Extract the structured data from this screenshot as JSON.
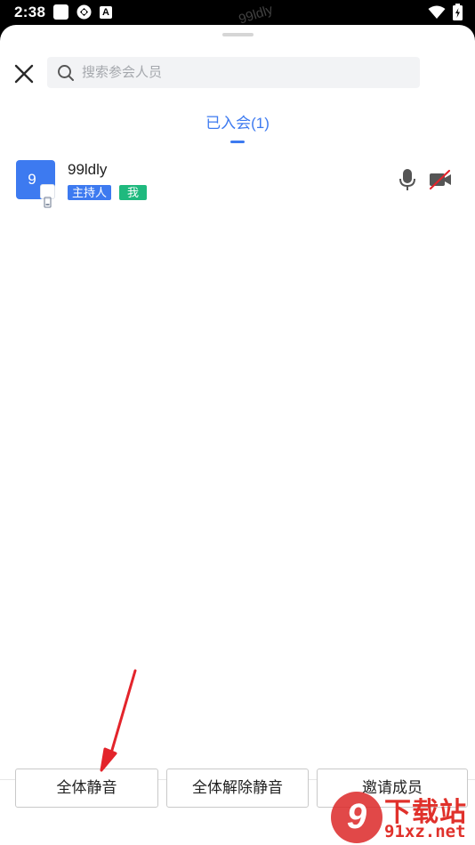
{
  "status_bar": {
    "time": "2:38",
    "watermark": "99ldly"
  },
  "header": {
    "search_placeholder": "搜索参会人员"
  },
  "tabs": [
    {
      "label": "已入会(1)",
      "active": true
    }
  ],
  "participants": [
    {
      "avatar_text": "9",
      "name": "99ldly",
      "tags": [
        "主持人",
        "我"
      ],
      "mic_on": true,
      "camera_on": false
    }
  ],
  "footer": {
    "mute_all_label": "全体静音",
    "unmute_all_label": "全体解除静音",
    "invite_label": "邀请成员"
  },
  "watermark_logo": {
    "mark": "9",
    "title": "下载站",
    "url": "91xz.net"
  },
  "colors": {
    "accent": "#3d7af0",
    "me_tag": "#1fb97e",
    "annotation_arrow": "#e3242b"
  },
  "icons": {
    "close": "close-icon",
    "search": "search-icon",
    "mic": "microphone-icon",
    "camera": "camera-off-icon",
    "device": "phone-device-icon"
  }
}
